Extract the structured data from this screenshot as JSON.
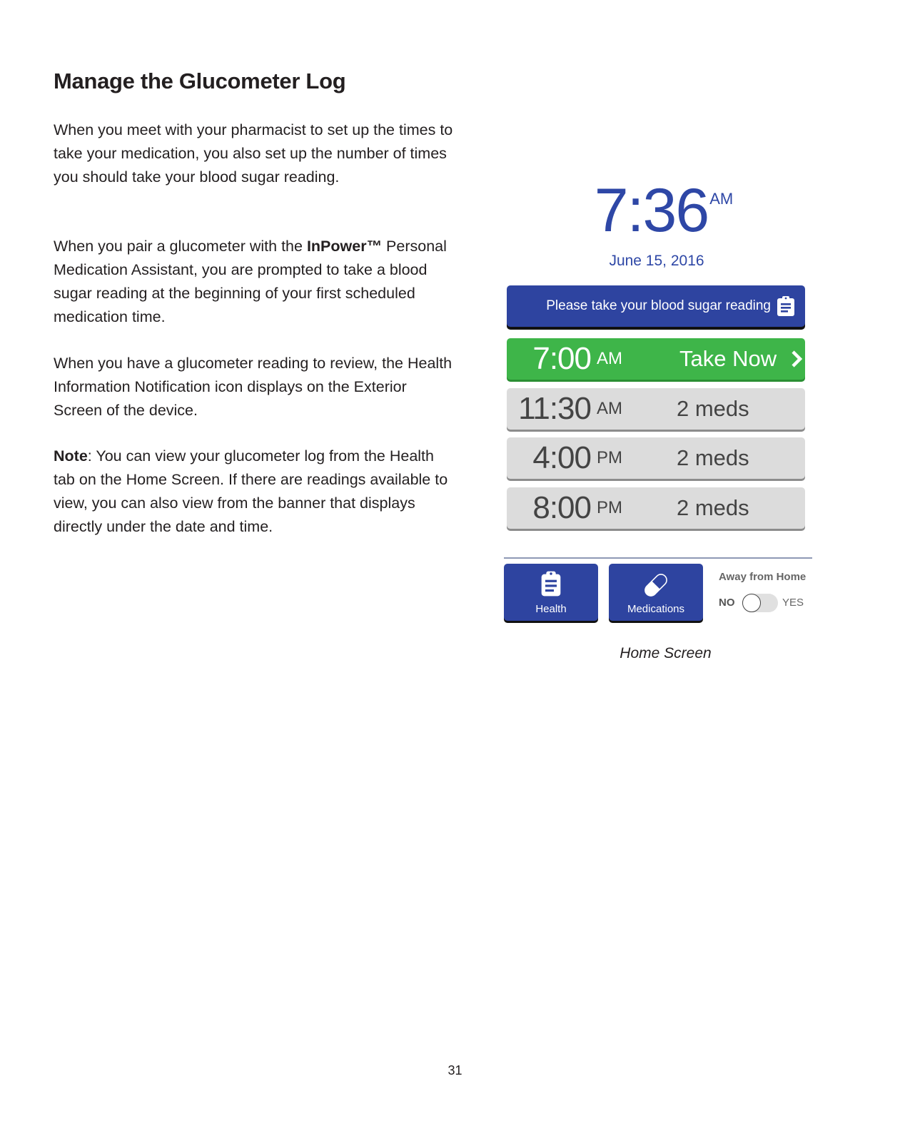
{
  "page": {
    "title": "Manage the Glucometer Log",
    "paragraphs": {
      "p1": "When you meet with your pharmacist to set up the times to take your medication, you also set up the number of times you should take your blood sugar reading.",
      "p2_pre": "When you pair a glucometer with the ",
      "p2_bold": "InPower™",
      "p2_post": " Personal Medication Assistant, you are prompted to take a blood sugar reading at the beginning of your first scheduled medication time.",
      "p3": "When you have a glucometer reading to review, the Health Information Notification icon displays on the Exterior Screen of the device.",
      "p4_bold": "Note",
      "p4_post": ": You can view your glucometer log from the Health tab on the Home Screen. If there are readings available to view, you can also view from the banner that displays directly under the date and time."
    },
    "caption": "Home Screen",
    "page_number": "31"
  },
  "device": {
    "clock": {
      "time": "7:36",
      "ampm": "AM"
    },
    "date": "June 15, 2016",
    "banner": {
      "text": "Please take your blood sugar reading",
      "icon": "clipboard-icon"
    },
    "schedule": [
      {
        "time": "7:00",
        "ampm": "AM",
        "status": "Take Now",
        "state": "due",
        "icon": "chevron-right-icon"
      },
      {
        "time": "11:30",
        "ampm": "AM",
        "status": "2 meds",
        "state": "upcoming"
      },
      {
        "time": "4:00",
        "ampm": "PM",
        "status": "2 meds",
        "state": "upcoming"
      },
      {
        "time": "8:00",
        "ampm": "PM",
        "status": "2 meds",
        "state": "upcoming"
      }
    ],
    "tiles": {
      "health": {
        "label": "Health",
        "icon": "clipboard-icon"
      },
      "medications": {
        "label": "Medications",
        "icon": "pill-icon"
      }
    },
    "away_from_home": {
      "title": "Away from Home",
      "off_label": "NO",
      "on_label": "YES",
      "value": false
    }
  },
  "colors": {
    "primary_blue": "#2e44a0",
    "clock_blue": "#2e47a6",
    "due_green": "#3eb549",
    "row_gray": "#dcdcdc"
  }
}
